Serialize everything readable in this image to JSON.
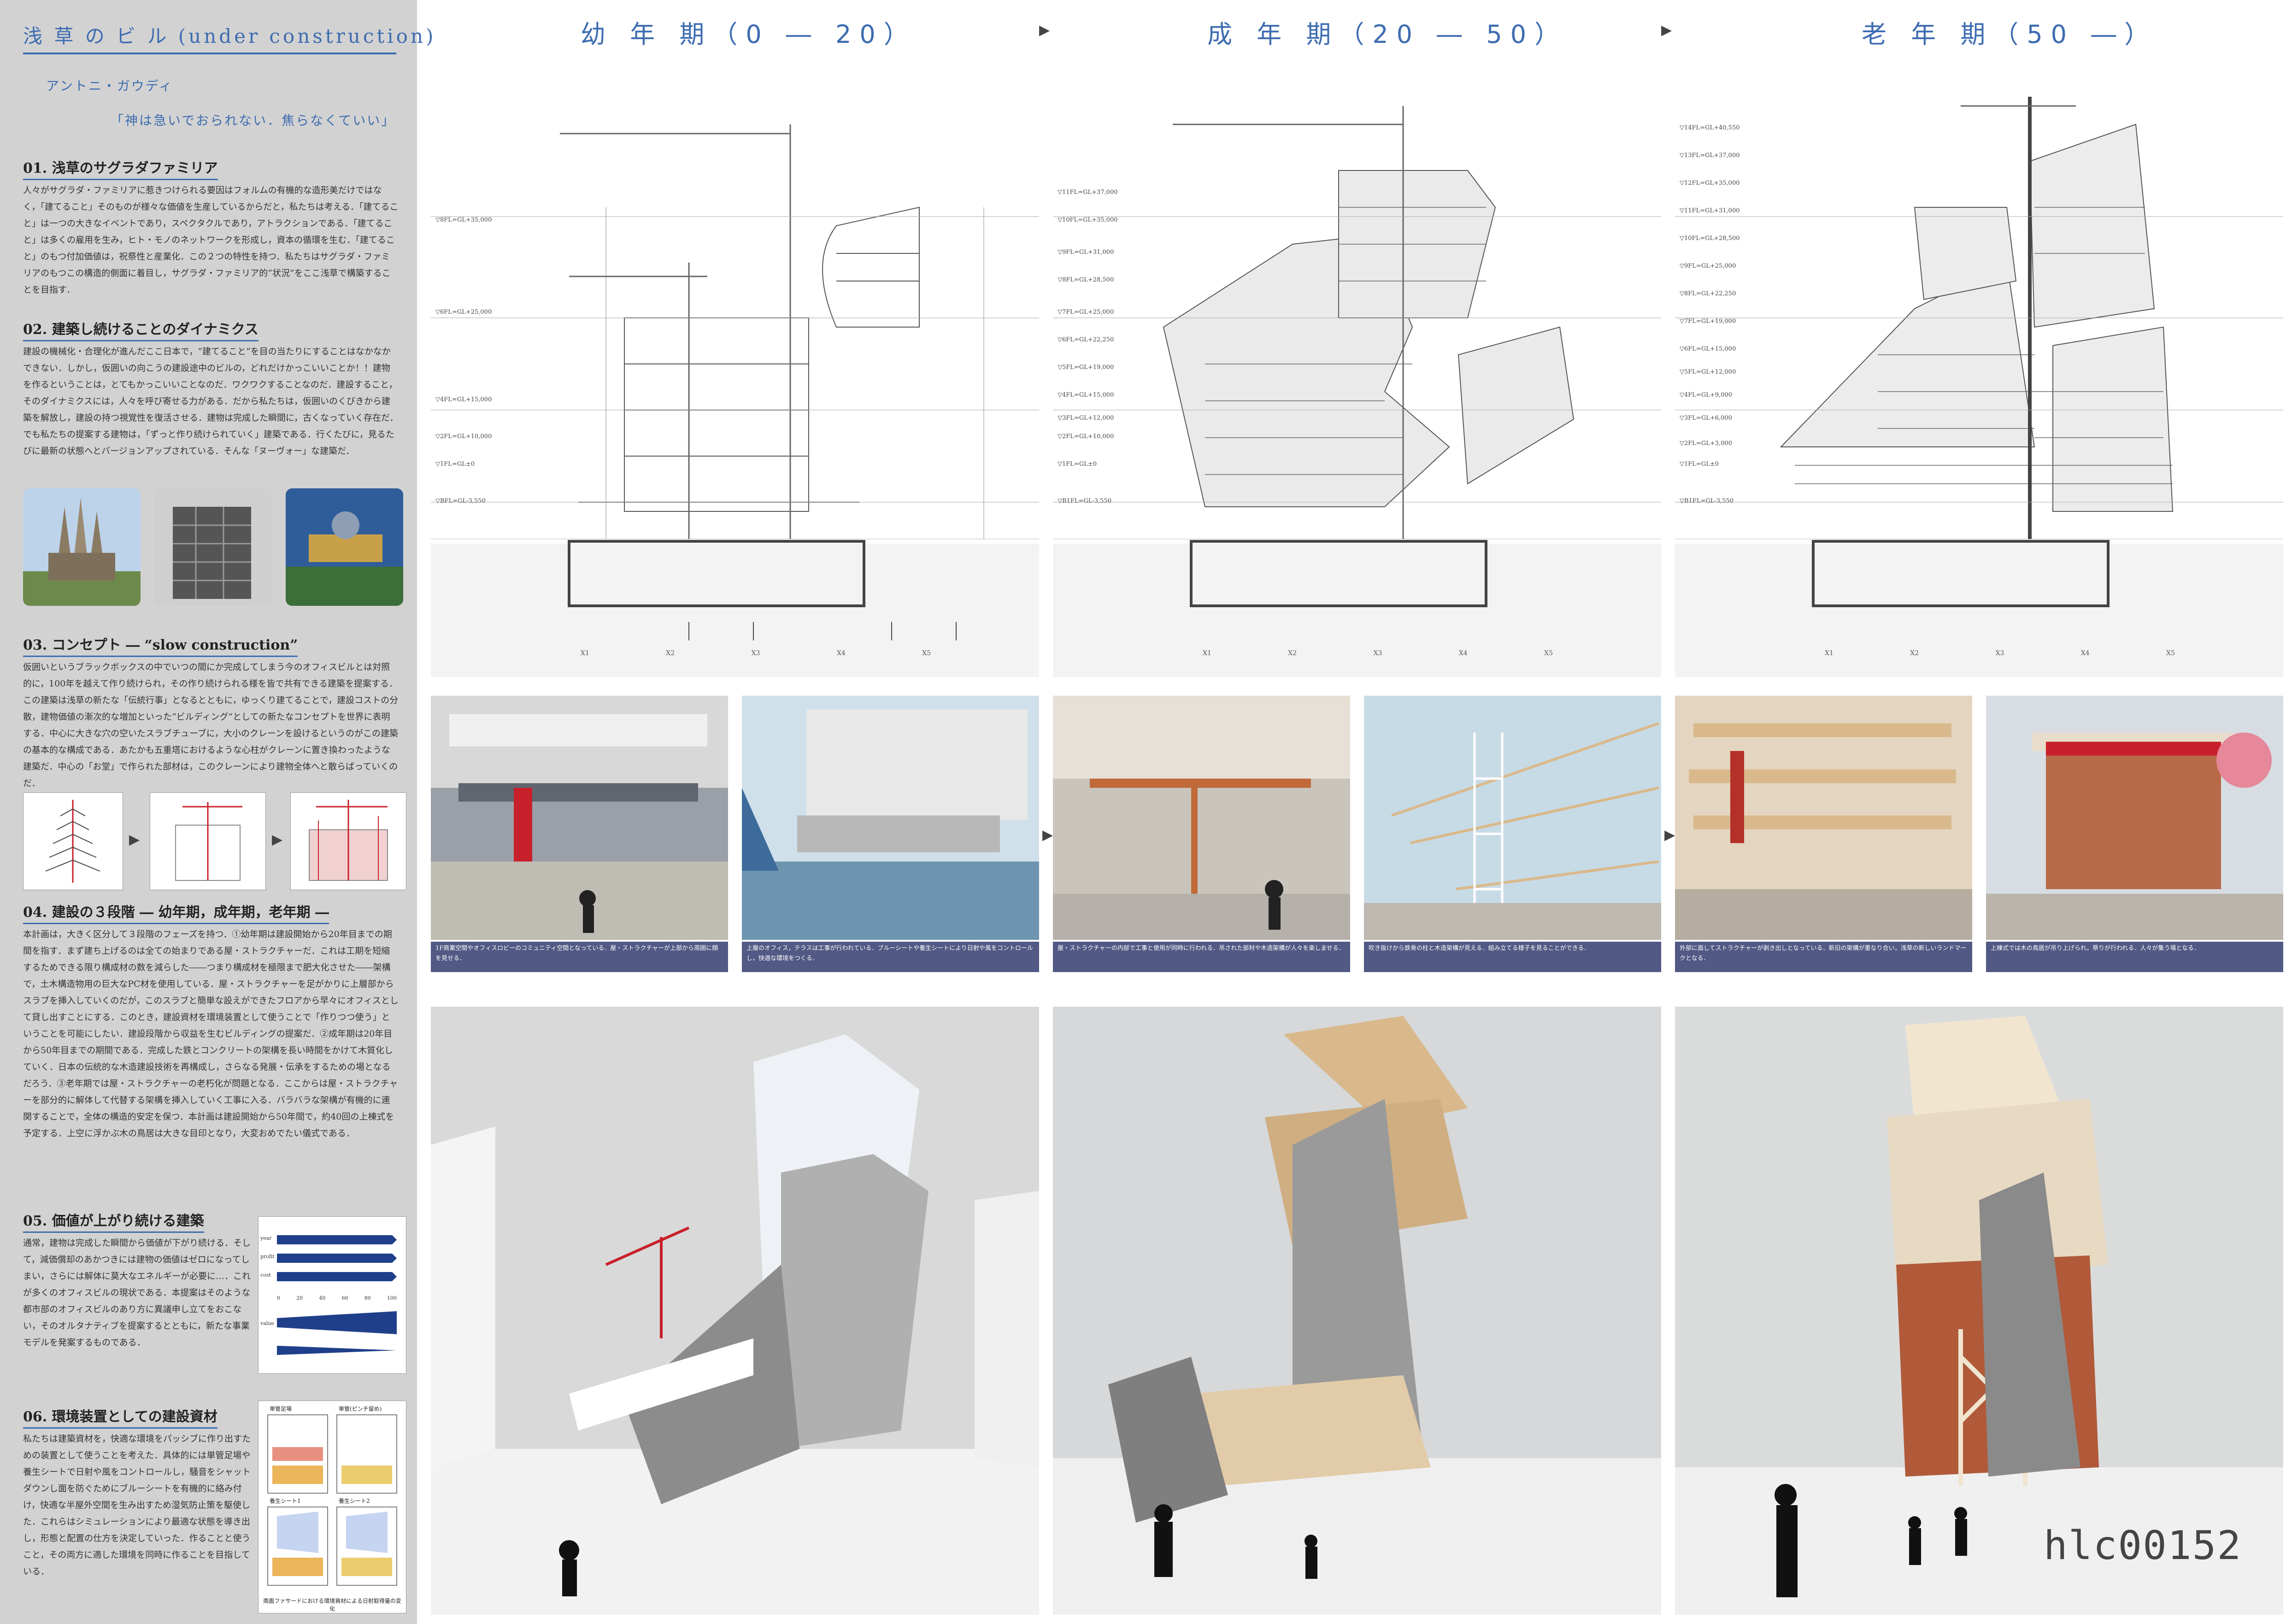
{
  "sidebar": {
    "title": "浅 草 の ビ ル (under construction)",
    "quote_author": "アントニ・ガウディ",
    "quote_text": "「神は急いでおられない．焦らなくていい」",
    "sections": [
      {
        "heading": "01. 浅草のサグラダファミリア",
        "body": "人々がサグラダ・ファミリアに惹きつけられる要因はフォルムの有機的な造形美だけではなく，「建てること」そのものが様々な価値を生産しているからだと，私たちは考える．「建てること」は一つの大きなイベントであり，スペクタクルであり，アトラクションである．「建てること」は多くの雇用を生み，ヒト・モノのネットワークを形成し，資本の循環を生む．「建てること」のもつ付加価値は，祝祭性と産業化．この２つの特性を持つ．私たちはサグラダ・ファミリアのもつこの構造的側面に着目し，サグラダ・ファミリア的“状況”をここ浅草で構築することを目指す．"
      },
      {
        "heading": "02. 建築し続けることのダイナミクス",
        "body": "建設の機械化・合理化が進んだここ日本で，“建てること”を目の当たりにすることはなかなかできない．しかし，仮囲いの向こうの建設途中のビルの，どれだけかっこいいことか！！建物を作るということは，とてもかっこいいことなのだ．ワクワクすることなのだ．建設すること，そのダイナミクスには，人々を呼び寄せる力がある．だから私たちは，仮囲いのくびきから建築を解放し，建設の持つ視覚性を復活させる．建物は完成した瞬間に，古くなっていく存在だ．でも私たちの提案する建物は，「ずっと作り続けられていく」建築である．行くたびに，見るたびに最新の状態へとバージョンアップされている．そんな「ヌーヴォー」な建築だ．"
      },
      {
        "heading": "03. コンセプト ― “slow construction”",
        "body": "仮囲いというブラックボックスの中でいつの間にか完成してしまう今のオフィスビルとは対照的に，100年を越えて作り続けられ，その作り続けられる様を皆で共有できる建築を提案する．この建築は浅草の新たな「伝統行事」となるとともに，ゆっくり建てることで，建設コストの分散，建物価値の漸次的な増加といった“ビルディング”としての新たなコンセプトを世界に表明する．中心に大きな穴の空いたスラブチューブに，大小のクレーンを設けるというのがこの建築の基本的な構成である．あたかも五重塔におけるような心柱がクレーンに置き換わったような建築だ．中心の「お堂」で作られた部材は，このクレーンにより建物全体へと散らばっていくのだ．"
      },
      {
        "heading": "04. 建設の３段階 ― 幼年期，成年期，老年期 ―",
        "body": "本計画は，大きく区分して３段階のフェーズを持つ．①幼年期は建設開始から20年目までの期間を指す．まず建ち上げるのは全ての始まりである屋・ストラクチャーだ．これは工期を短縮するためできる限り構成材の数を減らした――つまり構成材を極限まで肥大化させた――架構で，土木構造物用の巨大なPC材を使用している．屋・ストラクチャーを足がかりに上層部からスラブを挿入していくのだが，このスラブと簡単な設えができたフロアから早々にオフィスとして貸し出すことにする．このとき，建設資材を環境装置として使うことで「作りつつ使う」ということを可能にしたい．建設段階から収益を生むビルディングの提案だ．②成年期は20年目から50年目までの期間である．完成した鉄とコンクリートの架構を長い時間をかけて木質化していく．日本の伝統的な木造建設技術を再構成し，さらなる発展・伝承をするための場となるだろう．③老年期では屋・ストラクチャーの老朽化が問題となる．ここからは屋・ストラクチャーを部分的に解体して代替する架構を挿入していく工事に入る．バラバラな架構が有機的に連関することで，全体の構造的安定を保つ．本計画は建設開始から50年間で，約40回の上棟式を予定する．上空に浮かぶ木の鳥居は大きな目印となり，大変おめでたい儀式である．"
      },
      {
        "heading": "05. 価値が上がり続ける建築",
        "body": "通常，建物は完成した瞬間から価値が下がり続ける．そして，減価償却のあかつきには建物の価値はゼロになってしまい，さらには解体に莫大なエネルギーが必要に…．これが多くのオフィスビルの現状である．本提案はそのような都市部のオフィスビルのあり方に異議申し立てをおこない，そのオルタナティブを提案するとともに，新たな事業モデルを発案するものである．"
      },
      {
        "heading": "06. 環境装置としての建設資材",
        "body": "私たちは建築資材を，快適な環境をパッシブに作り出すための装置として使うことを考えた．具体的には単管足場や養生シートで日射や風をコントロールし，騒音をシャットダウンし面を防ぐためにブルーシートを有機的に絡み付け，快適な半屋外空間を生み出すため湿気防止策を駆使した．これらはシミュレーションにより最適な状態を導き出し，形態と配置の仕方を決定していった．作ることと使うこと，その両方に適した環境を同時に作ることを目指している．"
      }
    ],
    "concept_diagram_caption": "",
    "value_chart_labels": [
      "year",
      "profit",
      "cost",
      "value"
    ],
    "value_ticks": [
      "0",
      "20",
      "40",
      "60",
      "80",
      "100"
    ],
    "env_diagram_labels": [
      "単管足場",
      "単管(ピンチ留め)",
      "養生シート1",
      "養生シート2"
    ],
    "env_caption": "南面ファサードにおける環境資材による日射取得量の変化"
  },
  "stages": [
    {
      "label": "幼 年 期（0 ― 20）"
    },
    {
      "label": "成 年 期（20 ― 50）"
    },
    {
      "label": "老 年 期（50 ―）"
    }
  ],
  "section_labels": {
    "stage1": [
      "▽BFL=GL-3,550",
      "▽1FL=GL±0",
      "▽2FL=GL+10,000",
      "▽4FL=GL+15,000",
      "▽6FL=GL+25,000",
      "▽8FL=GL+35,000"
    ],
    "stage2": [
      "▽B1FL=GL-3,550",
      "▽1FL=GL±0",
      "▽2FL=GL+10,000",
      "▽3FL=GL+12,000",
      "▽4FL=GL+15,000",
      "▽5FL=GL+19,000",
      "▽6FL=GL+22,250",
      "▽7FL=GL+25,000",
      "▽8FL=GL+28,500",
      "▽9FL=GL+31,000",
      "▽10FL=GL+35,000",
      "▽11FL=GL+37,000"
    ],
    "stage3": [
      "▽B1FL=GL-3,550",
      "▽1FL=GL±0",
      "▽2FL=GL+3,000",
      "▽3FL=GL+6,000",
      "▽4FL=GL+9,000",
      "▽5FL=GL+12,000",
      "▽6FL=GL+15,000",
      "▽7FL=GL+19,000",
      "▽8FL=GL+22,250",
      "▽9FL=GL+25,000",
      "▽10FL=GL+28,500",
      "▽11FL=GL+31,000",
      "▽12FL=GL+35,000",
      "▽13FL=GL+37,000",
      "▽14FL=GL+40,550"
    ]
  },
  "grid_labels": [
    "X1",
    "X2",
    "X3",
    "X4",
    "X5"
  ],
  "captions": [
    "1F商業空間やオフィスロビーのコミュニティ空間となっている．屋・ストラクチャーが上部から周囲に顔を見せる．",
    "上層のオフィス，テラスは工事が行われている．ブルーシートや養生シートにより日射や風をコントロールし，快適な環境をつくる．",
    "屋・ストラクチャーの内部で工事と使用が同時に行われる．吊された部材や木造架構が人々を楽しませる．",
    "吹き抜けから鉄骨の柱と木造架構が見える．組み立てる様子を見ることができる．",
    "外部に面してストラクチャーが剥き出しとなっている．新旧の架構が重なり合い，浅草の新しいランドマークとなる．",
    "上棟式では木の鳥居が吊り上げられ，祭りが行われる．人々が集う場となる．"
  ],
  "badge": "hlc00152",
  "colors": {
    "accent": "#3d6cb0",
    "sidebar": "#d2d2d2",
    "crane": "#c8202a",
    "wood": "#d9b98c"
  }
}
